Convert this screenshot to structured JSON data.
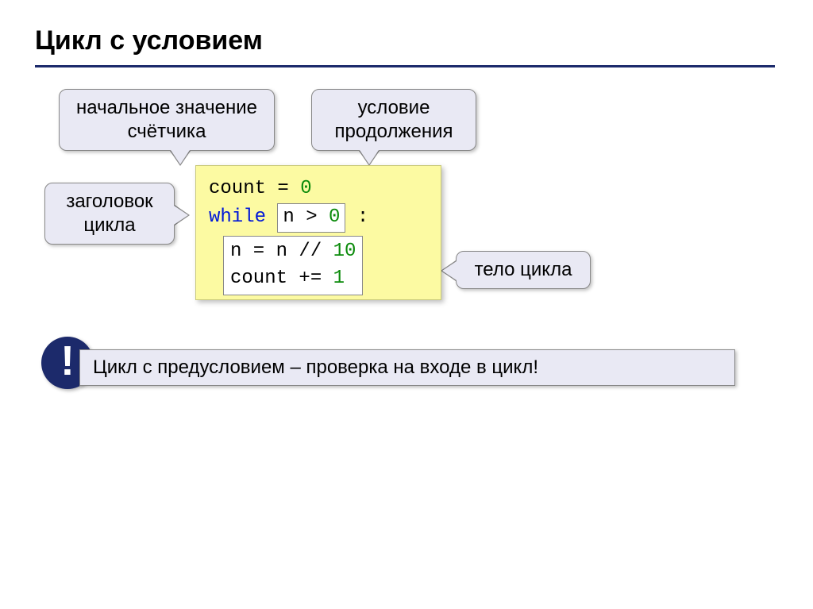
{
  "title": "Цикл с условием",
  "callouts": {
    "initial": "начальное значение\nсчётчика",
    "condition": "условие\nпродолжения",
    "header": "заголовок\nцикла",
    "body": "тело цикла"
  },
  "code": {
    "line1_a": "count",
    "line1_b": " = ",
    "line1_c": "0",
    "line2_kw": "while",
    "line2_cond_a": "n > ",
    "line2_cond_b": "0",
    "line2_end": " :",
    "line3_a": "n = n // ",
    "line3_b": "10",
    "line4_a": "count += ",
    "line4_b": "1"
  },
  "note": "Цикл с предусловием – проверка на входе в цикл!",
  "excl": "!"
}
